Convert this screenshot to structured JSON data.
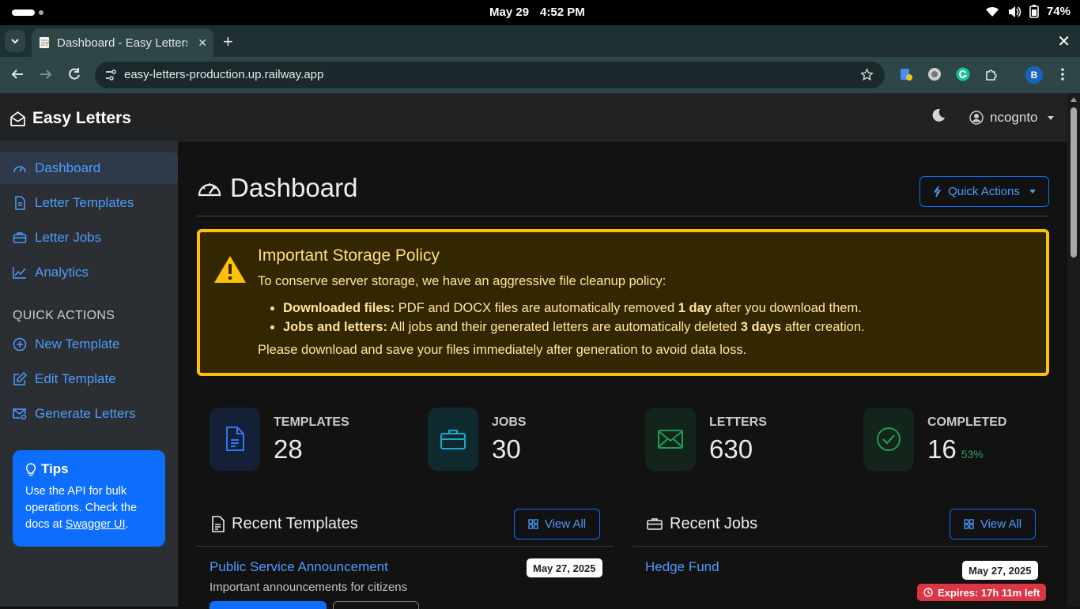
{
  "status_bar": {
    "date": "May 29",
    "time": "4:52 PM",
    "battery": "74%"
  },
  "browser": {
    "tab_title": "Dashboard - Easy Letters",
    "url": "easy-letters-production.up.railway.app",
    "profile_initial": "B"
  },
  "app": {
    "brand": "Easy Letters",
    "user": "ncognto"
  },
  "sidebar": {
    "items": [
      {
        "label": "Dashboard",
        "icon": "gauge-icon"
      },
      {
        "label": "Letter Templates",
        "icon": "file-text-icon"
      },
      {
        "label": "Letter Jobs",
        "icon": "briefcase-icon"
      },
      {
        "label": "Analytics",
        "icon": "graph-icon"
      }
    ],
    "section_label": "QUICK ACTIONS",
    "quick_actions": [
      {
        "label": "New Template",
        "icon": "plus-circle-icon"
      },
      {
        "label": "Edit Template",
        "icon": "pencil-square-icon"
      },
      {
        "label": "Generate Letters",
        "icon": "envelope-gear-icon"
      }
    ],
    "tips": {
      "title": "Tips",
      "text_before": "Use the API for bulk operations. Check the docs at ",
      "link": "Swagger UI",
      "text_after": "."
    }
  },
  "main": {
    "title": "Dashboard",
    "quick_actions_button": "Quick Actions",
    "alert": {
      "title": "Important Storage Policy",
      "intro": "To conserve server storage, we have an aggressive file cleanup policy:",
      "bullet1": {
        "bold": "Downloaded files:",
        "text1": " PDF and DOCX files are automatically removed ",
        "strong": "1 day",
        "text2": " after you download them."
      },
      "bullet2": {
        "bold": "Jobs and letters:",
        "text1": " All jobs and their generated letters are automatically deleted ",
        "strong": "3 days",
        "text2": " after creation."
      },
      "footer": "Please download and save your files immediately after generation to avoid data loss."
    },
    "stats": [
      {
        "label": "TEMPLATES",
        "value": "28",
        "icon": "file-text-icon",
        "color": "#1e6ff5"
      },
      {
        "label": "JOBS",
        "value": "30",
        "icon": "briefcase-icon",
        "color": "#18a3c7"
      },
      {
        "label": "LETTERS",
        "value": "630",
        "icon": "envelope-icon",
        "color": "#1f9d55"
      },
      {
        "label": "COMPLETED",
        "value": "16",
        "extra": "53%",
        "icon": "check-circle-icon",
        "color": "#1f9d55"
      }
    ],
    "recent_templates": {
      "title": "Recent Templates",
      "view_all": "View All",
      "items": [
        {
          "name": "Public Service Announcement",
          "description": "Important announcements for citizens",
          "date": "May 27, 2025"
        }
      ]
    },
    "recent_jobs": {
      "title": "Recent Jobs",
      "view_all": "View All",
      "items": [
        {
          "name": "Hedge Fund",
          "date": "May 27, 2025",
          "expires": "Expires: 17h 11m left"
        }
      ]
    }
  }
}
